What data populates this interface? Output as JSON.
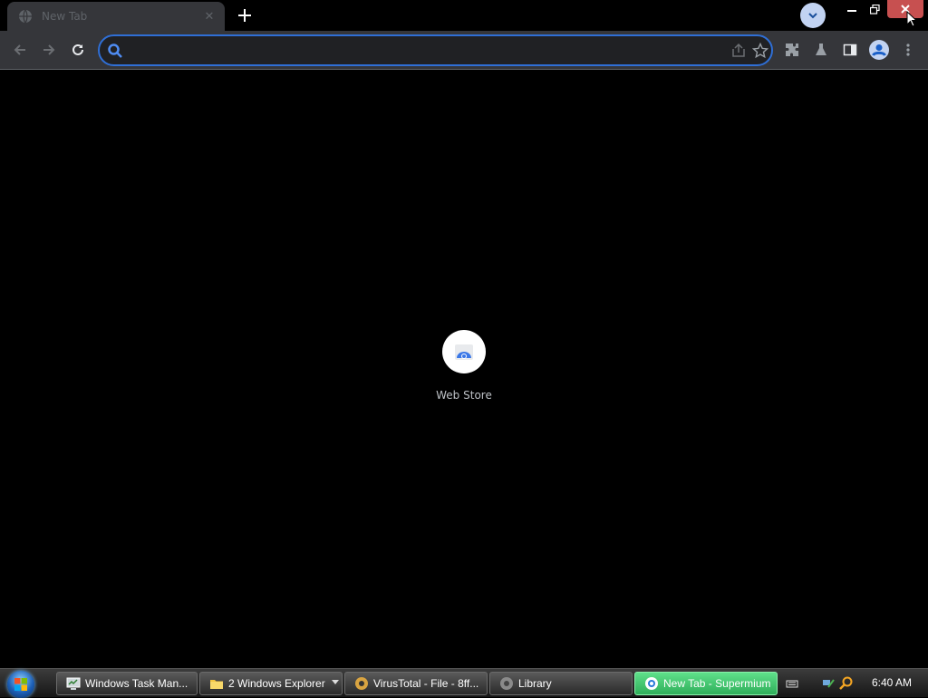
{
  "browser": {
    "tab": {
      "title": "New Tab"
    },
    "omnibox": {
      "value": "",
      "placeholder": ""
    },
    "accent_color": "#2f6fd6"
  },
  "page": {
    "shortcuts": [
      {
        "label": "Web Store",
        "icon": "web-store-icon"
      }
    ]
  },
  "taskbar": {
    "tasks": [
      {
        "label": "Windows Task Man...",
        "icon": "task-manager-icon"
      },
      {
        "label": "2 Windows Explorer",
        "icon": "folder-icon"
      },
      {
        "label": "VirusTotal - File - 8ff...",
        "icon": "supermium-icon"
      },
      {
        "label": "Library",
        "icon": "library-icon"
      },
      {
        "label": "New Tab - Supermium",
        "icon": "supermium-icon",
        "active": true
      }
    ],
    "clock": "6:40 AM",
    "active_color": "#3fc66a"
  }
}
